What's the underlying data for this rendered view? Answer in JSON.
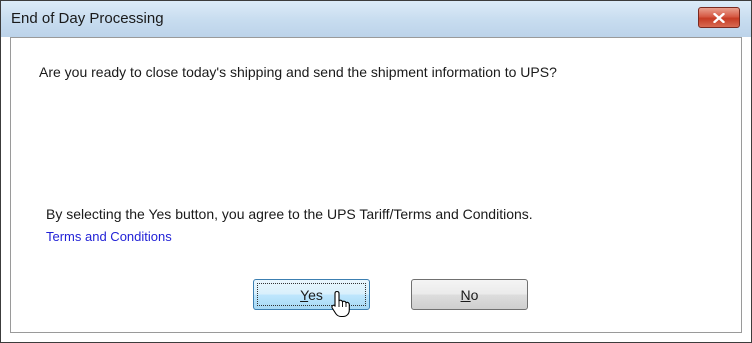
{
  "window": {
    "title": "End of Day Processing"
  },
  "dialog": {
    "question": "Are you ready to close today's shipping and send the shipment information to UPS?",
    "agreement": "By selecting the Yes button, you agree to the UPS Tariff/Terms and Conditions.",
    "terms_link": "Terms and Conditions"
  },
  "buttons": {
    "yes": {
      "mnemonic": "Y",
      "rest": "es"
    },
    "no": {
      "mnemonic": "N",
      "rest": "o"
    }
  },
  "icons": {
    "close": "close-icon",
    "cursor": "hand-pointer-cursor-icon"
  },
  "colors": {
    "link": "#1f1fd6",
    "close_button": "#c63b24",
    "title_bar": "#c7dcef"
  }
}
